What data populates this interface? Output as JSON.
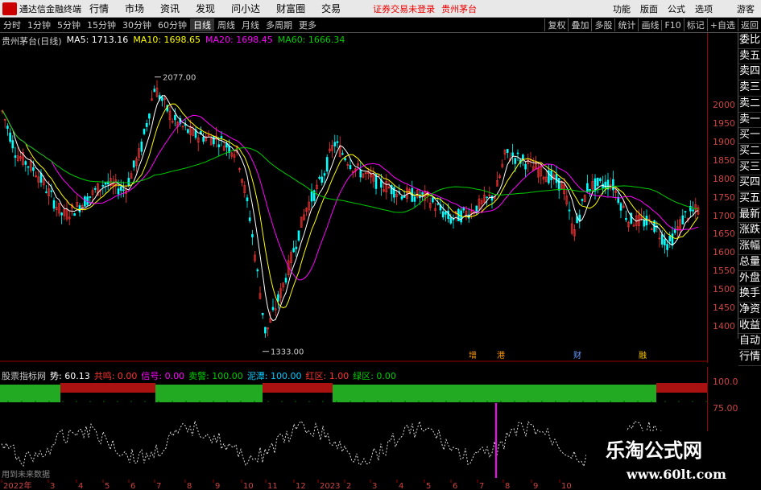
{
  "menubar": {
    "app_title": "通达信金融终端",
    "items": [
      "行情",
      "市场",
      "资讯",
      "发现",
      "问小达",
      "财富圈",
      "交易"
    ],
    "warning": "证券交易未登录",
    "stock": "贵州茅台",
    "right_items": [
      "功能",
      "版面",
      "公式",
      "选项"
    ],
    "guest": "游客"
  },
  "periods": [
    "分时",
    "1分钟",
    "5分钟",
    "15分钟",
    "30分钟",
    "60分钟",
    "日线",
    "周线",
    "月线",
    "多周期",
    "更多"
  ],
  "active_period": "日线",
  "toolbar": [
    "复权",
    "叠加",
    "多股",
    "统计",
    "画线",
    "F10",
    "标记",
    "+自选",
    "返回"
  ],
  "main_info": {
    "title": "贵州茅台(日线)",
    "ma5": "MA5: 1713.16",
    "ma10": "MA10: 1698.65",
    "ma20": "MA20: 1698.45",
    "ma60": "MA60: 1666.34"
  },
  "y_axis": [
    "2000",
    "1950",
    "1900",
    "1850",
    "1800",
    "1750",
    "1700",
    "1650",
    "1600",
    "1550",
    "1500",
    "1450",
    "1400"
  ],
  "price_high": "2077.00",
  "price_low": "1333.00",
  "event_markers": [
    "增",
    "港",
    "财",
    "融"
  ],
  "sub_info": {
    "title": "股票指标网",
    "trend": "势: 60.13",
    "v1": "共鸣: 0.00",
    "v2": "信号: 0.00",
    "v3": "卖警: 100.00",
    "v4": "泥潭: 100.00",
    "v5": "红区: 1.00",
    "v6": "绿区: 0.00"
  },
  "sub_y_axis": [
    "100.0",
    "75.00"
  ],
  "no_data": "用到未来数据",
  "x_axis": [
    "2022年",
    "3",
    "4",
    "5",
    "6",
    "7",
    "8",
    "9",
    "10",
    "11",
    "12",
    "2023",
    "2",
    "3",
    "4",
    "5",
    "6",
    "7",
    "8",
    "9",
    "10"
  ],
  "right_panel": [
    "委比",
    "卖五",
    "卖四",
    "卖三",
    "卖二",
    "卖一",
    "买一",
    "买二",
    "买三",
    "买四",
    "买五",
    "最新",
    "涨跌",
    "涨幅",
    "总量",
    "外盘",
    "换手",
    "净资",
    "收益",
    "自动",
    "行情"
  ],
  "watermark": {
    "title": "乐淘公式网",
    "url": "www.60lt.com"
  },
  "colors": {
    "up": "#ff3333",
    "down": "#00ffff",
    "ma5": "#ffffff",
    "ma10": "#ffff00",
    "ma20": "#ff00ff",
    "ma60": "#00cc00",
    "green_zone": "#22aa22",
    "red_zone": "#aa1111"
  }
}
